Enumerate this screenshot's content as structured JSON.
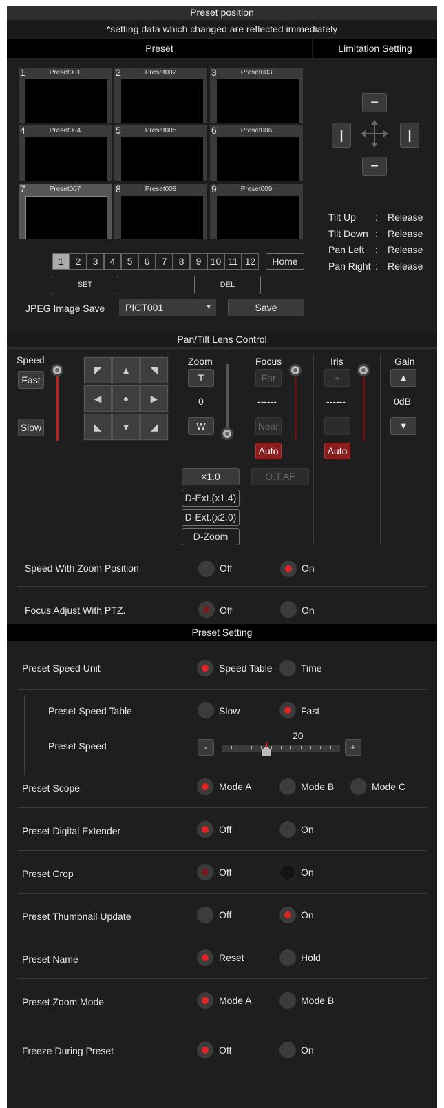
{
  "title": "Preset position",
  "subtitle": "*setting data which changed are reflected immediately",
  "preset": {
    "header": "Preset",
    "cells": [
      {
        "num": "1",
        "name": "Preset001"
      },
      {
        "num": "2",
        "name": "Preset002"
      },
      {
        "num": "3",
        "name": "Preset003"
      },
      {
        "num": "4",
        "name": "Preset004"
      },
      {
        "num": "5",
        "name": "Preset005"
      },
      {
        "num": "6",
        "name": "Preset006"
      },
      {
        "num": "7",
        "name": "Preset007"
      },
      {
        "num": "8",
        "name": "Preset008"
      },
      {
        "num": "9",
        "name": "Preset009"
      }
    ],
    "pages": [
      "1",
      "2",
      "3",
      "4",
      "5",
      "6",
      "7",
      "8",
      "9",
      "10",
      "11",
      "12"
    ],
    "home": "Home",
    "set": "SET",
    "del": "DEL",
    "jpeg_label": "JPEG Image Save",
    "jpeg_value": "PICT001",
    "save": "Save"
  },
  "limitation": {
    "header": "Limitation Setting",
    "rows": [
      {
        "name": "Tilt Up",
        "sep": ":",
        "value": "Release"
      },
      {
        "name": "Tilt Down",
        "sep": ":",
        "value": "Release"
      },
      {
        "name": "Pan Left",
        "sep": ":",
        "value": "Release"
      },
      {
        "name": "Pan Right",
        "sep": ":",
        "value": "Release"
      }
    ]
  },
  "lens": {
    "header": "Pan/Tilt Lens Control",
    "speed": "Speed",
    "fast": "Fast",
    "slow": "Slow",
    "zoom": "Zoom",
    "t": "T",
    "zoom_value": "0",
    "w": "W",
    "x10": "×1.0",
    "dext14": "D-Ext.(x1.4)",
    "dext20": "D-Ext.(x2.0)",
    "dzoom": "D-Zoom",
    "focus": "Focus",
    "far": "Far",
    "focus_value": "------",
    "near": "Near",
    "focus_auto": "Auto",
    "otaf": "O.T.AF",
    "iris": "Iris",
    "iris_plus": "+",
    "iris_value": "------",
    "iris_minus": "-",
    "iris_auto": "Auto",
    "gain": "Gain",
    "gain_value": "0dB",
    "speed_zoom": {
      "label": "Speed With Zoom Position",
      "opt1": "Off",
      "opt2": "On"
    },
    "focus_ptz": {
      "label": "Focus Adjust With PTZ.",
      "opt1": "Off",
      "opt2": "On"
    }
  },
  "setting": {
    "header": "Preset Setting",
    "speed_unit": {
      "label": "Preset Speed Unit",
      "opt1": "Speed Table",
      "opt2": "Time"
    },
    "speed_table": {
      "label": "Preset Speed Table",
      "opt1": "Slow",
      "opt2": "Fast"
    },
    "speed": {
      "label": "Preset Speed",
      "value": "20",
      "minus": "-",
      "plus": "+",
      "level": 0.38
    },
    "scope": {
      "label": "Preset Scope",
      "opt1": "Mode A",
      "opt2": "Mode B",
      "opt3": "Mode C"
    },
    "dext": {
      "label": "Preset Digital Extender",
      "opt1": "Off",
      "opt2": "On"
    },
    "crop": {
      "label": "Preset Crop",
      "opt1": "Off",
      "opt2": "On"
    },
    "thumb": {
      "label": "Preset Thumbnail Update",
      "opt1": "Off",
      "opt2": "On"
    },
    "name": {
      "label": "Preset Name",
      "opt1": "Reset",
      "opt2": "Hold"
    },
    "zoom_mode": {
      "label": "Preset Zoom Mode",
      "opt1": "Mode A",
      "opt2": "Mode B"
    },
    "freeze": {
      "label": "Freeze During Preset",
      "opt1": "Off",
      "opt2": "On"
    }
  }
}
